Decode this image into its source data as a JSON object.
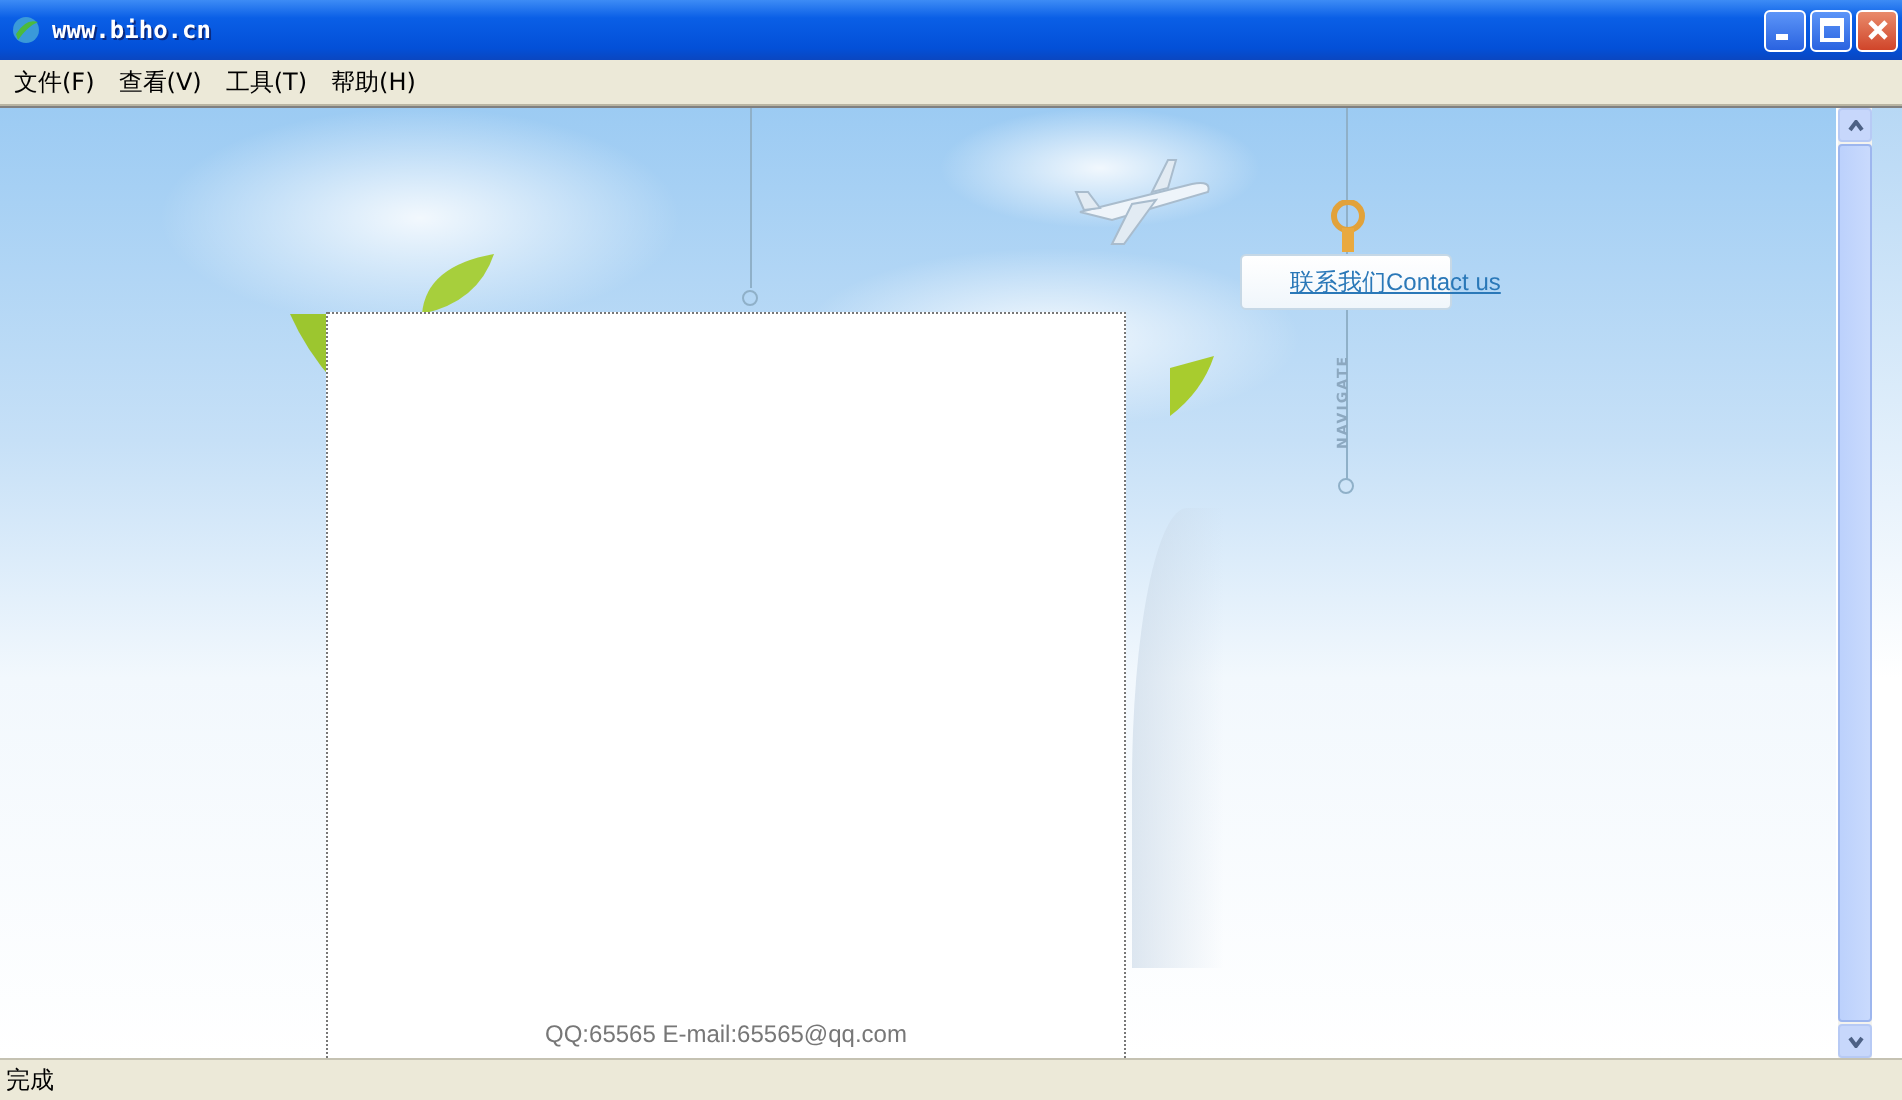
{
  "window": {
    "title": "www.biho.cn"
  },
  "menu": [
    {
      "label": "文件(F)"
    },
    {
      "label": "查看(V)"
    },
    {
      "label": "工具(T)"
    },
    {
      "label": "帮助(H)"
    }
  ],
  "page": {
    "contact_link": "联系我们Contact us",
    "nav_label": "NAVIGATE",
    "footer": "QQ:65565 E-mail:65565@qq.com"
  },
  "status_bar": {
    "text": "完成"
  }
}
